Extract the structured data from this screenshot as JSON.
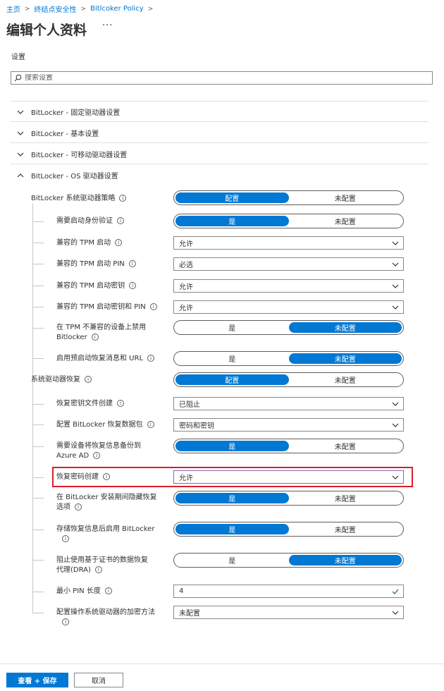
{
  "breadcrumb": [
    "主页",
    "终结点安全性",
    "Bitlcoker Policy"
  ],
  "page": {
    "title": "编辑个人资料",
    "more": "···"
  },
  "settings_label": "设置",
  "search": {
    "placeholder": "搜索设置"
  },
  "sections": [
    {
      "label": "BitLocker - 固定驱动器设置",
      "expanded": false
    },
    {
      "label": "BitLocker - 基本设置",
      "expanded": false
    },
    {
      "label": "BitLocker - 可移动驱动器设置",
      "expanded": false
    },
    {
      "label": "BitLocker - OS 驱动器设置",
      "expanded": true
    }
  ],
  "rows": [
    {
      "label": "BitLocker 系统驱动器策略",
      "type": "toggle",
      "options": [
        "配置",
        "未配置"
      ],
      "selected": 0
    },
    {
      "label": "需要启动身份验证",
      "type": "toggle",
      "options": [
        "是",
        "未配置"
      ],
      "selected": 0
    },
    {
      "label": "兼容的 TPM 启动",
      "type": "dropdown",
      "value": "允许"
    },
    {
      "label": "兼容的 TPM 启动 PIN",
      "type": "dropdown",
      "value": "必选"
    },
    {
      "label": "兼容的 TPM 启动密钥",
      "type": "dropdown",
      "value": "允许"
    },
    {
      "label": "兼容的 TPM 启动密钥和 PIN",
      "type": "dropdown",
      "value": "允许"
    },
    {
      "label": "在 TPM 不兼容的设备上禁用",
      "label2": "Bitlocker",
      "type": "toggle",
      "options": [
        "是",
        "未配置"
      ],
      "selected": 1
    },
    {
      "label": "启用预启动恢复消息和 URL",
      "type": "toggle",
      "options": [
        "是",
        "未配置"
      ],
      "selected": 1
    },
    {
      "label": "系统驱动器恢复",
      "type": "toggle",
      "options": [
        "配置",
        "未配置"
      ],
      "selected": 0
    },
    {
      "label": "恢复密钥文件创建",
      "type": "dropdown",
      "value": "已阻止"
    },
    {
      "label": "配置 BitLocker 恢复数据包",
      "type": "dropdown",
      "value": "密码和密钥"
    },
    {
      "label": "需要设备将恢复信息备份到",
      "label2": "Azure AD",
      "type": "toggle",
      "options": [
        "是",
        "未配置"
      ],
      "selected": 0
    },
    {
      "label": "恢复密码创建",
      "type": "dropdown",
      "value": "允许"
    },
    {
      "label": "在 BitLocker 安装期间隐藏恢复",
      "label2": "选项",
      "type": "toggle",
      "options": [
        "是",
        "未配置"
      ],
      "selected": 0
    },
    {
      "label": "存储恢复信息后启用 BitLocker",
      "type": "toggle",
      "options": [
        "是",
        "未配置"
      ],
      "selected": 0
    },
    {
      "label": "阻止使用基于证书的数据恢复",
      "label2": "代理(DRA)",
      "type": "toggle",
      "options": [
        "是",
        "未配置"
      ],
      "selected": 1
    },
    {
      "label": "最小 PIN 长度",
      "type": "input",
      "value": "4"
    },
    {
      "label": "配置操作系统驱动器的加密方法",
      "type": "dropdown",
      "value": "未配置"
    }
  ],
  "footer": {
    "save": "查看 + 保存",
    "cancel": "取消"
  },
  "colors": {
    "accent": "#0078d4",
    "highlight": "#d81e2c",
    "valid": "#107c10"
  }
}
